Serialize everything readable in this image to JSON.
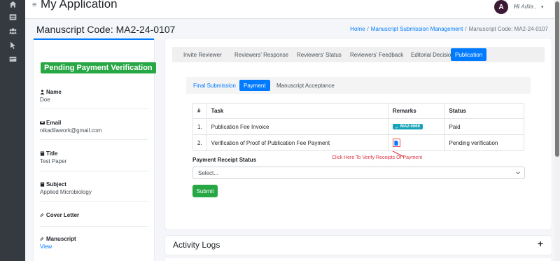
{
  "app": {
    "title": "My Application",
    "menu_icon": "hamburger-icon",
    "user_initial": "A",
    "greeting_prefix": "Hi",
    "greeting_name": "Adila ,"
  },
  "sidebar": {
    "icons": [
      "home-icon",
      "table-icon",
      "users-icon",
      "cursor-icon",
      "card-icon"
    ]
  },
  "page": {
    "heading": "Manuscript Code: MA2-24-0107",
    "breadcrumb": [
      "Home",
      "Manuscript Submission Management",
      "Manuscript Code: MA2-24-0107"
    ]
  },
  "profile": {
    "status": "Pending Payment Verification",
    "fields": [
      {
        "label": "Name",
        "value": "Doe",
        "icon": "user-icon"
      },
      {
        "label": "Email",
        "value": "nikadilawork@gmail.com",
        "icon": "envelope-icon"
      },
      {
        "label": "Title",
        "value": "Test Paper",
        "icon": "book-icon"
      },
      {
        "label": "Subject",
        "value": "Applied Microbiology",
        "icon": "book-icon"
      },
      {
        "label": "Cover Letter",
        "value": "",
        "icon": "paperclip-icon"
      },
      {
        "label": "Manuscript",
        "value": "View",
        "icon": "paperclip-icon"
      }
    ]
  },
  "tabs": [
    "Invite Reviewer",
    "Reviewers' Response",
    "Reviewers' Status",
    "Reviewers' Feedback",
    "Editorial Decision",
    "Publication"
  ],
  "active_tab": "Publication",
  "subtabs": [
    "Final Submission",
    "Payment",
    "Manuscript Acceptance"
  ],
  "active_subtab": "Payment",
  "table": {
    "headers": [
      "#",
      "Task",
      "Remarks",
      "Status"
    ],
    "rows": [
      {
        "num": "1.",
        "task": "Publication Fee Invoice",
        "remark": "MA2-0069",
        "status": "Paid"
      },
      {
        "num": "2.",
        "task": "Verification of Proof of Publication Fee Payment",
        "remark": "file-icon",
        "status": "Pending verification"
      }
    ]
  },
  "hint": "Click Here To Verify Receipts Of Payment",
  "form": {
    "label": "Payment Receipt Status",
    "select_value": "Select...",
    "submit": "Submit"
  },
  "activity": {
    "title": "Activity Logs",
    "toggle": "+"
  },
  "colors": {
    "primary": "#007bff",
    "success": "#28a745",
    "info": "#17a2b8",
    "danger": "#dc3545",
    "sidebar": "#343a40"
  }
}
